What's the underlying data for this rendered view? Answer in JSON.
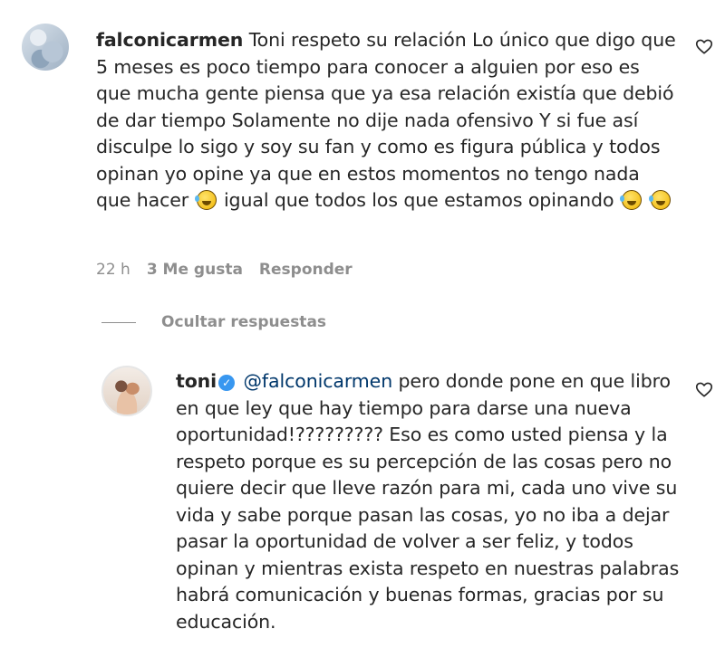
{
  "comment": {
    "username": "falconicarmen",
    "text_parts": [
      "Toni respeto su relación Lo único que digo que 5 meses es poco tiempo para conocer a alguien por eso es que mucha gente piensa que ya esa relación existía que debió de dar tiempo Solamente no dije nada ofensivo Y si fue así disculpe lo sigo y soy su fan y como es figura pública y todos opinan yo opine ya que en estos momentos no tengo nada que hacer",
      "igual que todos los que estamos opinando"
    ],
    "emoji": "rolling-on-floor-laughing",
    "time": "22 h",
    "likes": "3 Me gusta",
    "reply_label": "Responder"
  },
  "hide_replies_label": "Ocultar respuestas",
  "reply": {
    "username": "toni",
    "verified": true,
    "mention": "@falconicarmen",
    "text": "pero donde pone en que libro en que ley que hay tiempo para darse una nueva oportunidad!????????? Eso es como usted piensa y la respeto porque es su percepción de las cosas pero no quiere decir que lleve razón para mi, cada uno vive su vida y sabe porque pasan las cosas, yo no iba a dejar pasar la oportunidad de volver a ser feliz, y todos opinan y mientras exista respeto en nuestras palabras habrá comunicación y buenas formas, gracias por su educación."
  },
  "colors": {
    "text": "#262626",
    "secondary": "#8e8e8e",
    "mention": "#00376b",
    "verified": "#3897f0"
  },
  "icons": {
    "like": "heart-outline-icon",
    "verified": "verified-badge-icon"
  }
}
